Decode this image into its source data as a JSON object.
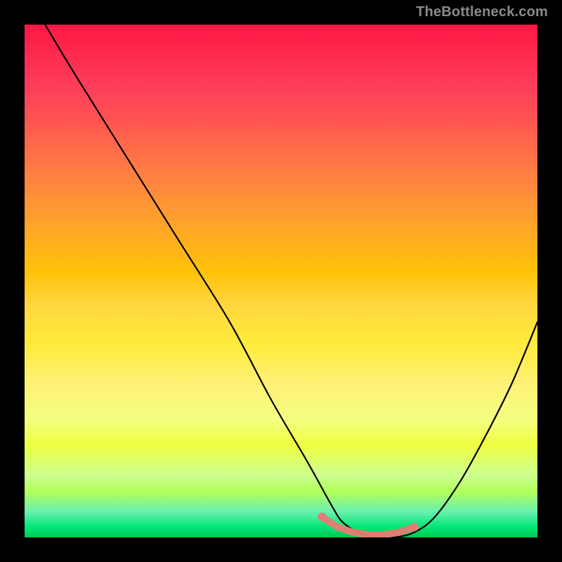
{
  "watermark": {
    "text": "TheBottleneck.com"
  },
  "colors": {
    "background": "#000000",
    "curve": "#000000",
    "marker": "#e77b73"
  },
  "chart_data": {
    "type": "line",
    "title": "",
    "xlabel": "",
    "ylabel": "",
    "xlim": [
      0,
      100
    ],
    "ylim": [
      0,
      100
    ],
    "grid": false,
    "series": [
      {
        "name": "bottleneck-curve",
        "x": [
          4,
          10,
          20,
          30,
          40,
          48,
          55,
          60,
          62,
          65,
          68,
          72,
          76,
          80,
          85,
          90,
          95,
          100
        ],
        "y": [
          100,
          90,
          74,
          58,
          42,
          27,
          15,
          6,
          3,
          1,
          0,
          0,
          1,
          4,
          11,
          20,
          30,
          42
        ]
      },
      {
        "name": "optimal-zone-markers",
        "x": [
          58,
          61,
          64,
          67,
          70,
          73,
          76
        ],
        "y": [
          4,
          2,
          1,
          0.5,
          0.5,
          1,
          2
        ]
      }
    ],
    "annotations": []
  }
}
